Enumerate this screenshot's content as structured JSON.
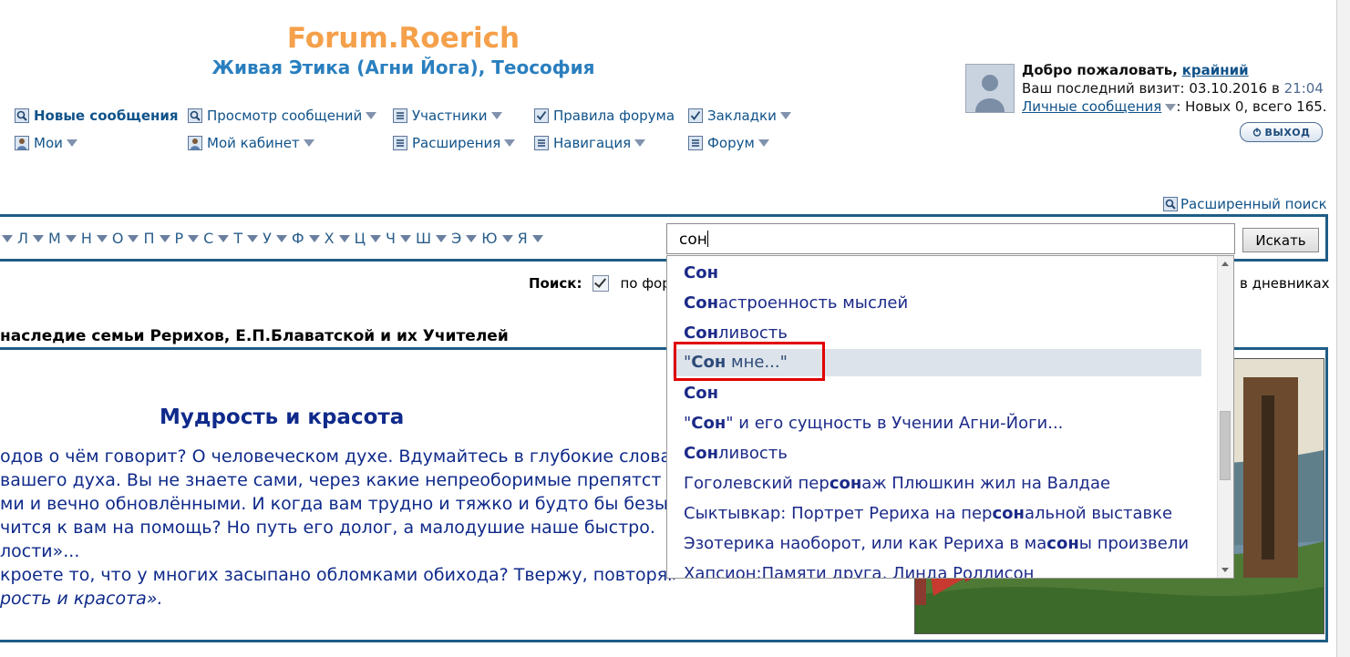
{
  "header": {
    "title": "Forum.Roerich",
    "subtitle": "Живая Этика (Агни Йога), Теософия"
  },
  "nav": {
    "row1": [
      "Новые сообщения",
      "Просмотр сообщений",
      "Участники",
      "Правила форума",
      "Закладки"
    ],
    "row2": [
      "Мои",
      "Мой кабинет",
      "Расширения",
      "Навигация",
      "Форум"
    ]
  },
  "user": {
    "welcome_prefix": "Добро пожаловать,",
    "username": "крайний",
    "last_visit_prefix": "Ваш последний визит: 03.10.2016 в",
    "last_visit_time": "21:04",
    "pm_link": "Личные сообщения",
    "pm_status": ": Новых 0, всего 165.",
    "logout": "ВЫХОД"
  },
  "advanced_search": "Расширенный поиск",
  "alphabet": [
    "Л",
    "М",
    "Н",
    "О",
    "П",
    "Р",
    "С",
    "Т",
    "У",
    "Ф",
    "Х",
    "Ц",
    "Ч",
    "Ш",
    "Э",
    "Ю",
    "Я"
  ],
  "search": {
    "value": "сон",
    "button": "Искать",
    "label": "Поиск:",
    "scope_forum": "по фор",
    "scope_diaries": "в дневниках"
  },
  "autocomplete": [
    {
      "bold": "Сон",
      "rest": ""
    },
    {
      "bold": "Сон",
      "rest": "астроенность мыслей"
    },
    {
      "bold": "Сон",
      "rest": "ливость"
    },
    {
      "pre": "\"",
      "bold": "Сон",
      "rest": " мне...\""
    },
    {
      "bold": "Сон",
      "rest": ""
    },
    {
      "pre": "\"",
      "bold": "Сон",
      "rest": "\" и его сущность в Учении Агни-Йоги..."
    },
    {
      "bold": "Сон",
      "rest": "ливость"
    },
    {
      "pre": "Гоголевский пер",
      "bold": "сон",
      "rest": "аж Плюшкин жил на Валдае"
    },
    {
      "pre": "Сыктывкар: Портрет Рериха на пер",
      "bold": "сон",
      "rest": "альной выставке"
    },
    {
      "pre": "Эзотерика наоборот, или как Рериха в ма",
      "bold": "сон",
      "rest": "ы произвели"
    },
    {
      "pre": "Хапсион:Памяти друга, Линда Роллисон",
      "bold": "",
      "rest": ""
    }
  ],
  "section_heading": "наследие семьи Рерихов, Е.П.Блаватской и их Учителей",
  "article": {
    "title": "Мудрость и красота",
    "lines": [
      "одов о чём говорит? О человеческом духе. Вдумайтесь в глубокие слова",
      " вашего духа. Вы не знаете сами, через какие непреоборимые препятст",
      "ми и вечно обновлёнными. И когда вам трудно и тяжко и будто бы безы",
      "чится к вам на помощь? Но путь его долог, а малодушие наше быстро.",
      "лости»...",
      "кроете то, что у многих засыпано обломками обихода? Твержу, повторяю: красота явлена",
      "рость и красота»."
    ]
  }
}
